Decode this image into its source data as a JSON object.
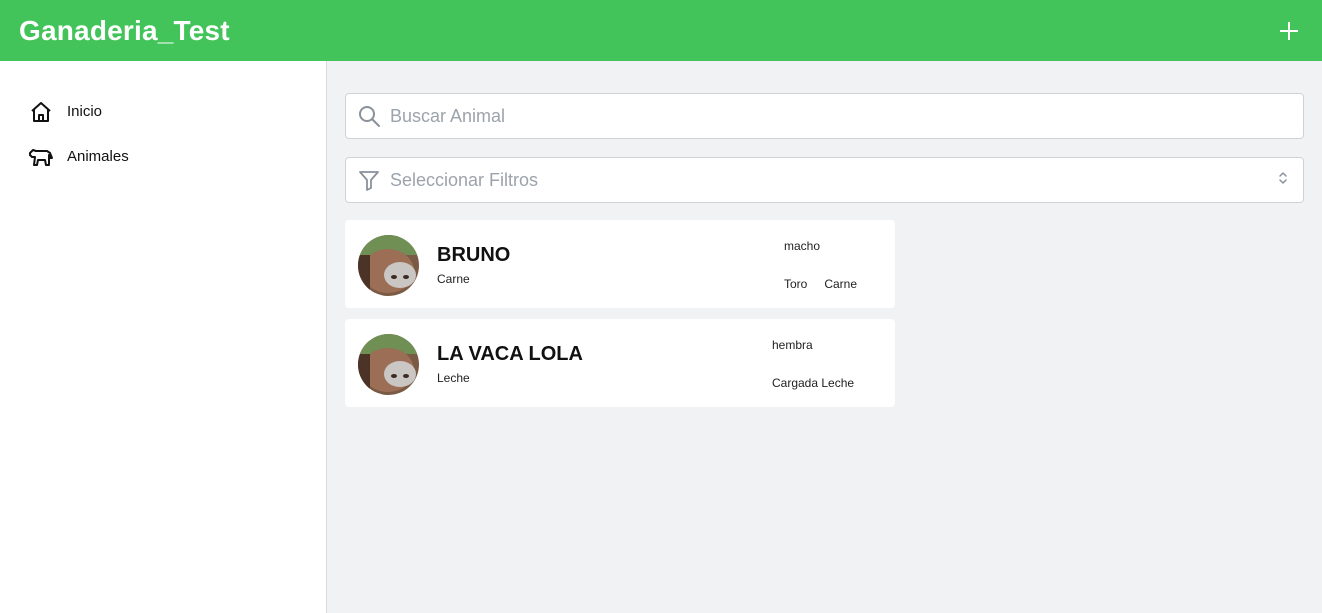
{
  "header": {
    "title": "Ganaderia_Test",
    "add_icon": "plus-icon"
  },
  "colors": {
    "accent": "#43c45a",
    "background": "#f1f2f4"
  },
  "sidebar": {
    "items": [
      {
        "label": "Inicio",
        "icon": "home-icon"
      },
      {
        "label": "Animales",
        "icon": "animal-icon"
      }
    ]
  },
  "search": {
    "placeholder": "Buscar Animal",
    "value": "",
    "icon": "search-icon"
  },
  "filters": {
    "placeholder": "Seleccionar Filtros",
    "icon": "filter-icon"
  },
  "animals": [
    {
      "name": "BRUNO",
      "type": "Carne",
      "sex": "macho",
      "tags": [
        "Toro",
        "Carne"
      ]
    },
    {
      "name": "LA VACA LOLA",
      "type": "Leche",
      "sex": "hembra",
      "tags": [
        "Cargada",
        "Leche"
      ]
    }
  ]
}
